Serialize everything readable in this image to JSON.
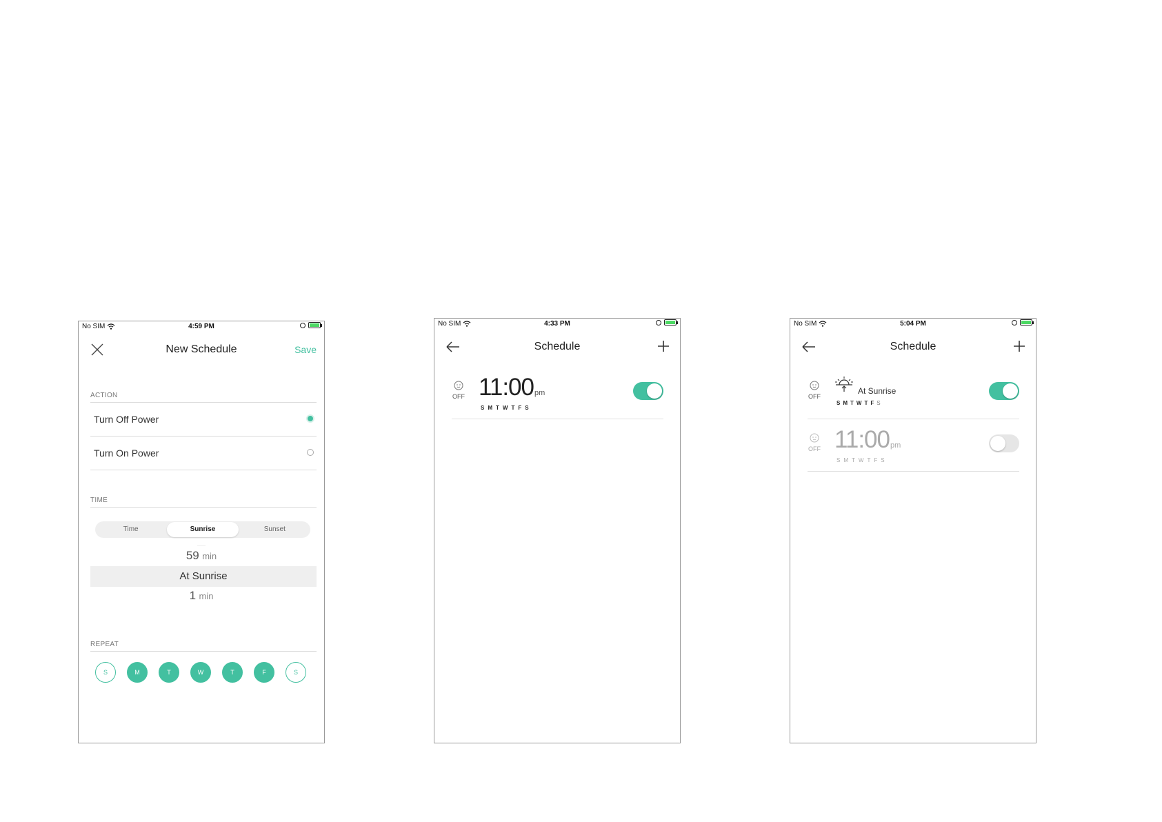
{
  "screens": {
    "new_schedule": {
      "status": {
        "carrier": "No SIM",
        "time": "4:59 PM"
      },
      "nav": {
        "title": "New Schedule",
        "save_label": "Save"
      },
      "action": {
        "label": "ACTION",
        "options": [
          {
            "label": "Turn Off Power",
            "selected": true
          },
          {
            "label": "Turn On Power",
            "selected": false
          }
        ]
      },
      "time": {
        "label": "TIME",
        "segments": [
          "Time",
          "Sunrise",
          "Sunset"
        ],
        "active_segment": "Sunrise",
        "picker": {
          "above": {
            "num": "59",
            "unit": "min"
          },
          "selected": "At Sunrise",
          "below": {
            "num": "1",
            "unit": "min"
          }
        }
      },
      "repeat": {
        "label": "REPEAT",
        "days": [
          {
            "letter": "S",
            "on": false
          },
          {
            "letter": "M",
            "on": true
          },
          {
            "letter": "T",
            "on": true
          },
          {
            "letter": "W",
            "on": true
          },
          {
            "letter": "T",
            "on": true
          },
          {
            "letter": "F",
            "on": true
          },
          {
            "letter": "S",
            "on": false
          }
        ]
      }
    },
    "schedule_a": {
      "status": {
        "carrier": "No SIM",
        "time": "4:33 PM"
      },
      "nav": {
        "title": "Schedule"
      },
      "items": [
        {
          "state": "OFF",
          "time": "11:00",
          "suffix": "pm",
          "days": "SMTWTFS",
          "enabled": true
        }
      ]
    },
    "schedule_b": {
      "status": {
        "carrier": "No SIM",
        "time": "5:04 PM"
      },
      "nav": {
        "title": "Schedule"
      },
      "items": [
        {
          "state": "OFF",
          "label": "At Sunrise",
          "days_bold": "SMTWTF",
          "days_light": "S",
          "enabled": true
        },
        {
          "state": "OFF",
          "time": "11:00",
          "suffix": "pm",
          "days": "SMTWTFS",
          "enabled": false
        }
      ]
    }
  },
  "colors": {
    "accent": "#43c0a0",
    "toggle_off": "#e6e6e6",
    "battery": "#4cd964"
  }
}
